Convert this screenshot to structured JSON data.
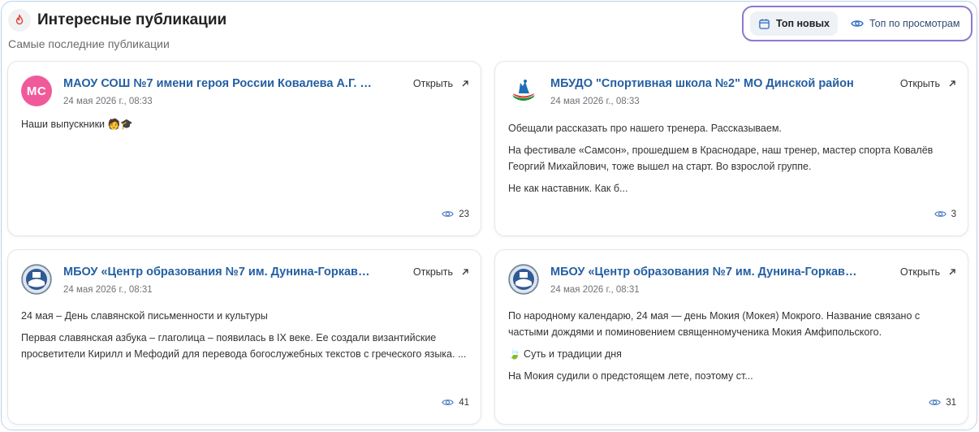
{
  "header": {
    "title": "Интересные публикации",
    "subtitle": "Самые последние публикации",
    "icon": "fire-icon"
  },
  "sort": {
    "top_new_label": "Топ новых",
    "top_views_label": "Топ по просмотрам",
    "active": "top_new"
  },
  "colors": {
    "accent_link": "#235fa3",
    "switch_outline": "#8d79d1",
    "avatar_initials_bg": "#f15a9a",
    "border": "#b9d3ea"
  },
  "posts": [
    {
      "author": "МАОУ СОШ №7 имени героя России Ковалева А.Г. К...",
      "avatar_initials": "МС",
      "date": "24 мая 2026 г., 08:33",
      "open_label": "Открыть",
      "paragraphs": [
        "Наши выпускники 🧑🎓"
      ],
      "views": "23"
    },
    {
      "author": "МБУДО \"Спортивная школа №2\" МО Динской район",
      "avatar_logo": "sports-school-logo",
      "date": "24 мая 2026 г., 08:33",
      "open_label": "Открыть",
      "paragraphs": [
        "Обещали рассказать про нашего тренера. Рассказываем.",
        "На фестивале «Самсон», прошедшем в Краснодаре, наш тренер, мастер спорта Ковалёв Георгий Михайлович, тоже вышел на старт. Во взрослой группе.",
        "Не как наставник. Как б..."
      ],
      "views": "3"
    },
    {
      "author": "МБОУ «Центр образования №7 им. Дунина-Горкави...",
      "avatar_logo": "education-center-emblem",
      "date": "24 мая 2026 г., 08:31",
      "open_label": "Открыть",
      "paragraphs": [
        "24 мая – День славянской письменности и культуры",
        "Первая славянская азбука – глаголица – появилась в IX веке. Ее создали византийские просветители Кирилл и Мефодий для перевода богослужебных текстов с греческого языка. ..."
      ],
      "views": "41"
    },
    {
      "author": "МБОУ «Центр образования №7 им. Дунина-Горкави...",
      "avatar_logo": "education-center-emblem",
      "date": "24 мая 2026 г., 08:31",
      "open_label": "Открыть",
      "paragraphs": [
        "По народному календарю, 24 мая — день Мокия (Мокея) Мокрого. Название связано с частыми дождями и поминовением священномученика Мокия Амфипольского.",
        "🍃 Суть и традиции дня",
        "На Мокия судили о предстоящем лете, поэтому ст..."
      ],
      "views": "31"
    }
  ]
}
